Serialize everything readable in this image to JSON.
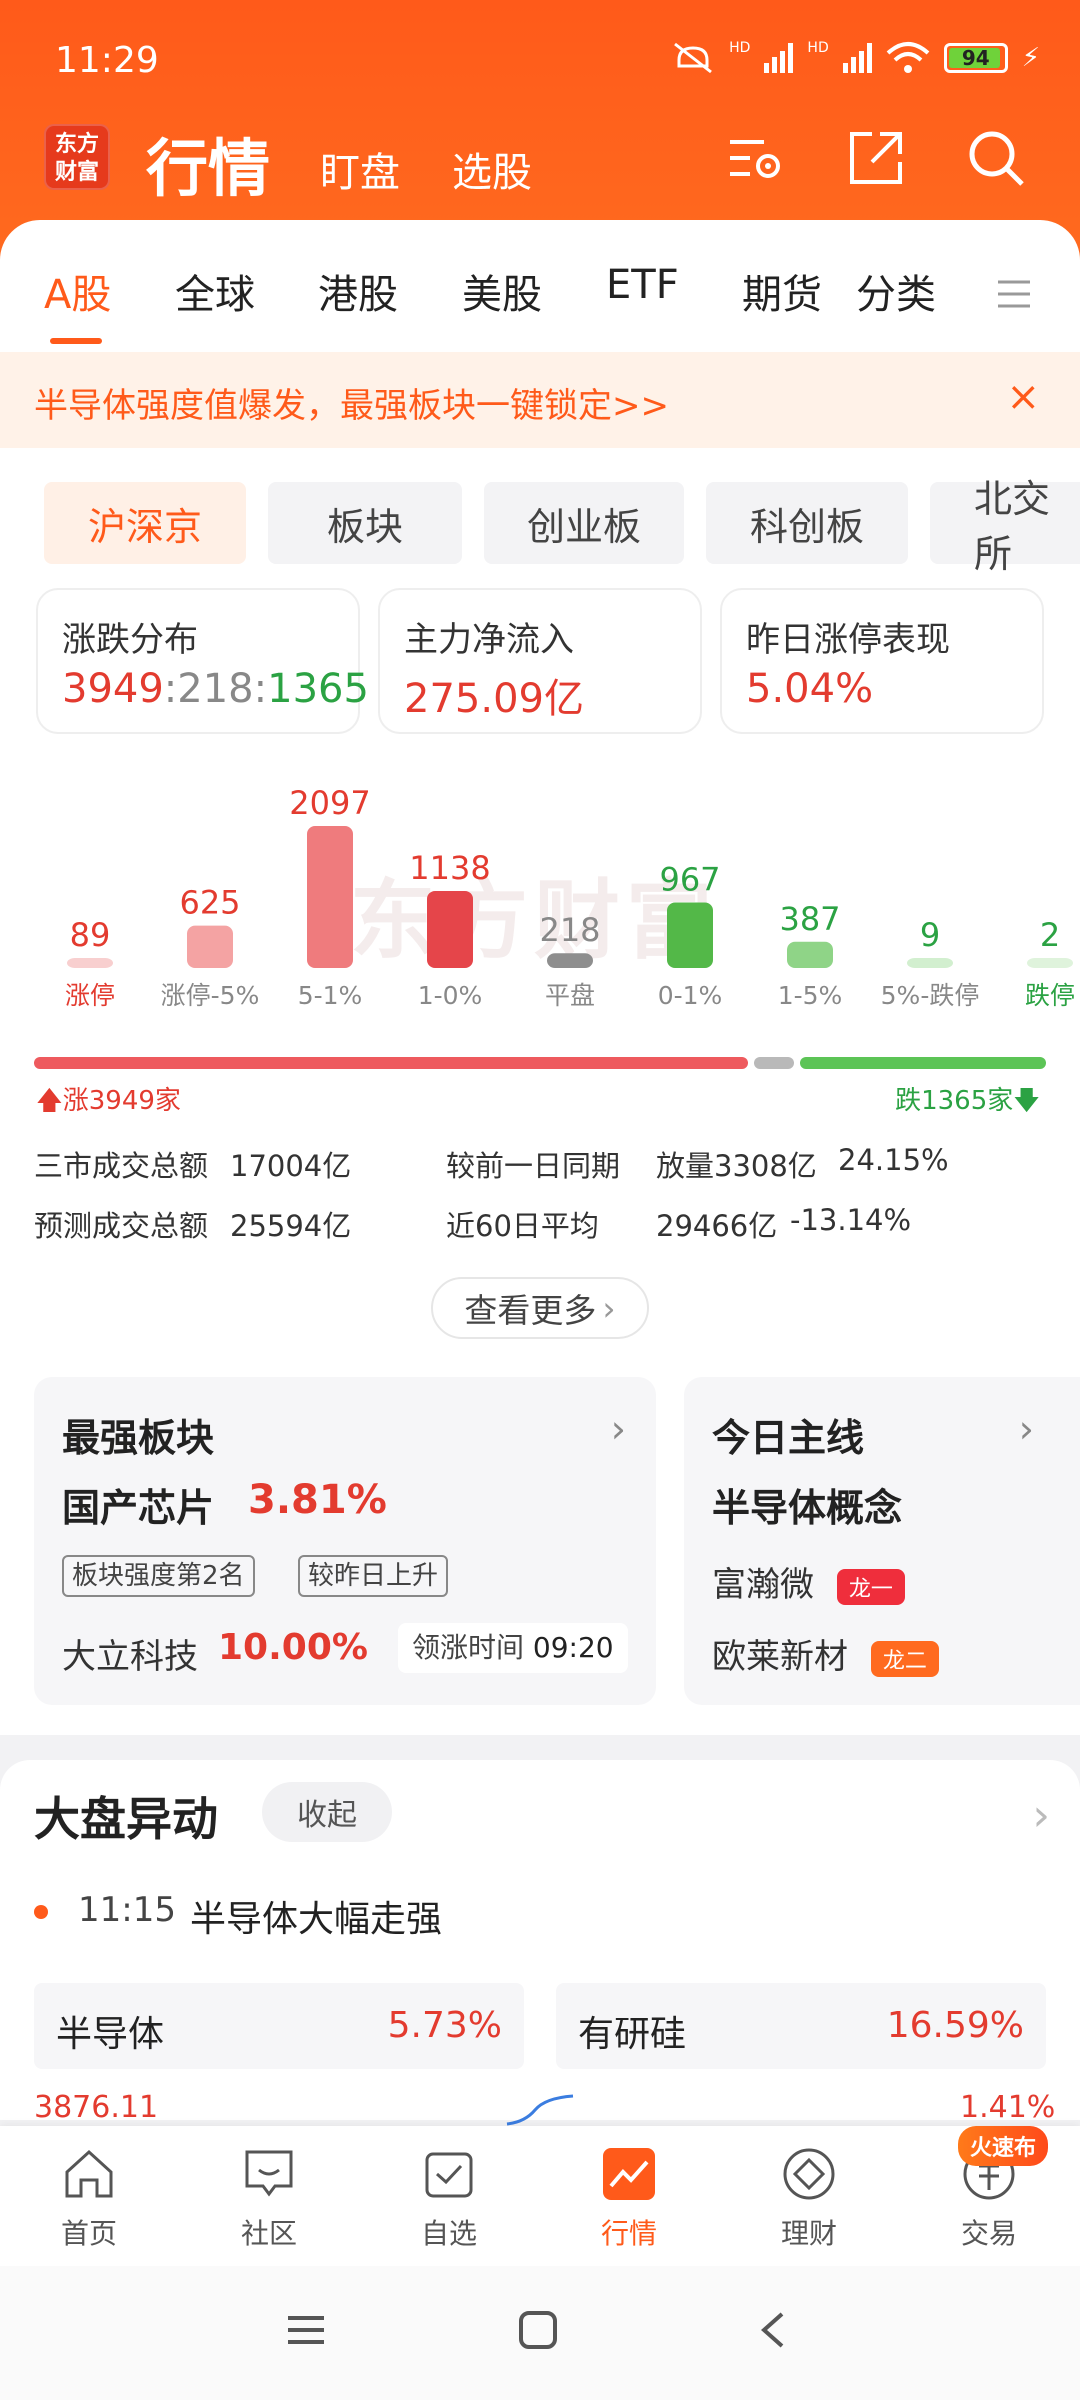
{
  "status_bar": {
    "time": "11:29",
    "battery": "94",
    "hd1": "HD",
    "hd2": "HD"
  },
  "header": {
    "logo_text_line1": "东方",
    "logo_text_line2": "财富",
    "title": "行情",
    "sub_nav": [
      "盯盘",
      "选股"
    ]
  },
  "market_tabs": [
    "A股",
    "全球",
    "港股",
    "美股",
    "ETF",
    "期货",
    "分类"
  ],
  "banner": {
    "text": "半导体强度值爆发，最强板块一键锁定>>"
  },
  "chips": [
    "沪深京",
    "板块",
    "创业板",
    "科创板",
    "北交所"
  ],
  "stats": {
    "dist": {
      "label": "涨跌分布",
      "up": "3949",
      "sep": ":",
      "flat": "218",
      "down": "1365"
    },
    "flow": {
      "label": "主力净流入",
      "value": "275.09亿"
    },
    "limit": {
      "label": "昨日涨停表现",
      "value": "5.04%"
    }
  },
  "chart_data": {
    "type": "bar",
    "categories": [
      "涨停",
      "涨停-5%",
      "5-1%",
      "1-0%",
      "平盘",
      "0-1%",
      "1-5%",
      "5%-跌停",
      "跌停"
    ],
    "values": [
      89,
      625,
      2097,
      1138,
      218,
      967,
      387,
      9,
      2
    ],
    "colors": [
      "#f8cfcf",
      "#f4a3a3",
      "#ef7b7d",
      "#e5454a",
      "#8e8e8e",
      "#53b848",
      "#8fd487",
      "#d2efcf",
      "#dff3dc"
    ],
    "label_colors": [
      "#e33b2f",
      "#e33b2f",
      "#e33b2f",
      "#e33b2f",
      "#888888",
      "#2ba243",
      "#2ba243",
      "#2ba243",
      "#2ba243"
    ],
    "cat_colors": [
      "#e33b2f",
      "#888888",
      "#888888",
      "#888888",
      "#888888",
      "#888888",
      "#888888",
      "#888888",
      "#2ba243"
    ]
  },
  "watermark": "东方财富",
  "ratio": {
    "up_label": "涨3949家",
    "down_label": "跌1365家",
    "up": 3949,
    "flat": 218,
    "down": 1365
  },
  "turnover": {
    "total_label": "三市成交总额",
    "total_value": "17004亿",
    "compare_label": "较前一日同期",
    "compare_value": "放量3308亿",
    "compare_pct": "24.15%",
    "forecast_label": "预测成交总额",
    "forecast_value": "25594亿",
    "avg_label": "近60日平均",
    "avg_value": "29466亿",
    "avg_pct": "-13.14%"
  },
  "more_button": "查看更多",
  "strongest": {
    "title": "最强板块",
    "sector": "国产芯片",
    "sector_pct": "3.81%",
    "tag1": "板块强度第2名",
    "tag2": "较昨日上升",
    "stock": "大立科技",
    "stock_pct": "10.00%",
    "lead_label": "领涨时间",
    "lead_time": "09:20"
  },
  "mainline": {
    "title": "今日主线",
    "theme": "半导体概念",
    "stock1": "富瀚微",
    "badge1": "龙一",
    "stock2": "欧莱新材",
    "badge2": "龙二"
  },
  "moves": {
    "title": "大盘异动",
    "collapse": "收起",
    "event_time": "11:15",
    "event_text": "半导体大幅走强",
    "card1_name": "半导体",
    "card1_pct": "5.73%",
    "card2_name": "有研硅",
    "card2_pct": "16.59%",
    "peek_left": "3876.11",
    "peek_right": "1.41%"
  },
  "bottom_nav": [
    "首页",
    "社区",
    "自选",
    "行情",
    "理财",
    "交易"
  ],
  "hot_badge": "火速布"
}
